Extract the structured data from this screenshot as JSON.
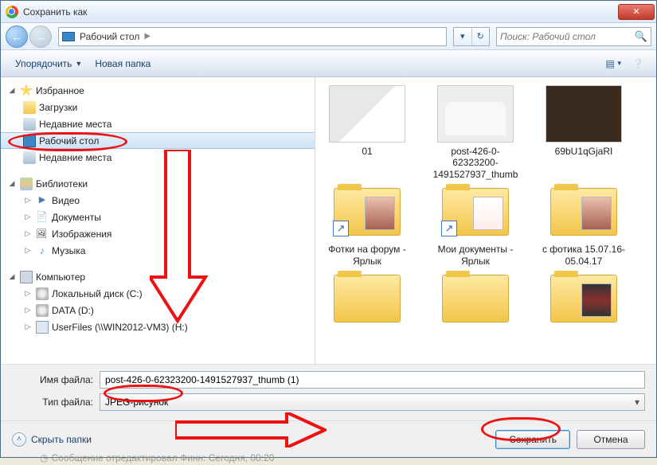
{
  "window": {
    "title": "Сохранить как"
  },
  "nav": {
    "breadcrumb": "Рабочий стол",
    "search_placeholder": "Поиск: Рабочий стол"
  },
  "toolbar": {
    "organize": "Упорядочить",
    "new_folder": "Новая папка"
  },
  "tree": {
    "favorites": "Избранное",
    "downloads": "Загрузки",
    "recent1": "Недавние места",
    "desktop": "Рабочий стол",
    "recent2": "Недавние места",
    "libraries": "Библиотеки",
    "video": "Видео",
    "documents": "Документы",
    "pictures": "Изображения",
    "music": "Музыка",
    "computer": "Компьютер",
    "local_c": "Локальный диск (C:)",
    "data_d": "DATA (D:)",
    "userfiles": "UserFiles (\\\\WIN2012-VM3) (H:)"
  },
  "items": [
    {
      "name": "01",
      "kind": "img1"
    },
    {
      "name": "post-426-0-62323200-1491527937_thumb",
      "kind": "car"
    },
    {
      "name": "69bU1qGjaRI",
      "kind": "dark"
    },
    {
      "name": "Фотки на форум - Ярлык",
      "kind": "shortcut",
      "inside": "photo"
    },
    {
      "name": "Мои документы - Ярлык",
      "kind": "shortcut",
      "inside": "doc"
    },
    {
      "name": "с фотика 15.07.16-05.04.17",
      "kind": "folder",
      "inside": "photo2"
    },
    {
      "name": "",
      "kind": "folder-plain"
    },
    {
      "name": "",
      "kind": "folder-plain"
    },
    {
      "name": "",
      "kind": "folder-strip"
    }
  ],
  "fields": {
    "filename_label": "Имя файла:",
    "filename_value": "post-426-0-62323200-1491527937_thumb (1)",
    "filetype_label": "Тип файла:",
    "filetype_value": "JPEG-рисунок"
  },
  "buttons": {
    "hide_folders": "Скрыть папки",
    "save": "Сохранить",
    "cancel": "Отмена"
  },
  "statusbar": "Сообщение отредактировал Финн: Сегодня, 08:20"
}
